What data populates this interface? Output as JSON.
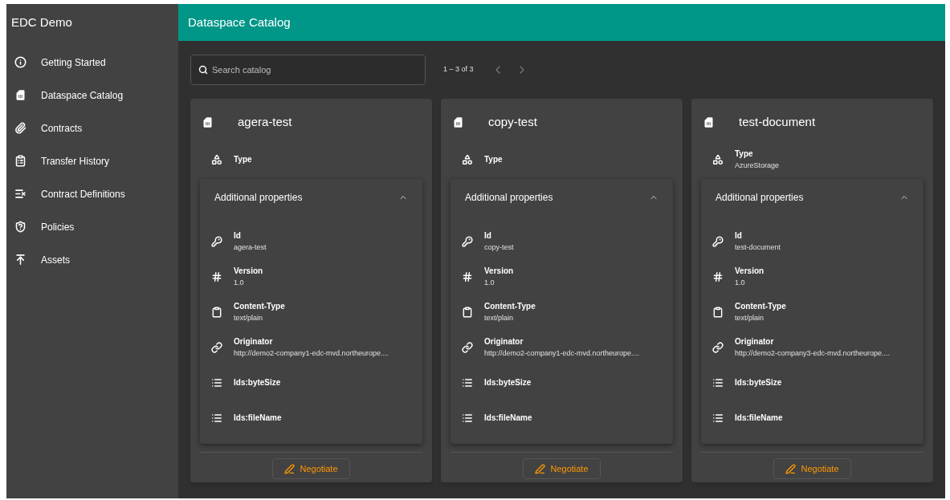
{
  "app_title": "EDC Demo",
  "nav": [
    {
      "label": "Getting Started",
      "kind": "info"
    },
    {
      "label": "Dataspace Catalog",
      "kind": "sim"
    },
    {
      "label": "Contracts",
      "kind": "clip"
    },
    {
      "label": "Transfer History",
      "kind": "clipboard"
    },
    {
      "label": "Contract Definitions",
      "kind": "listx"
    },
    {
      "label": "Policies",
      "kind": "shield"
    },
    {
      "label": "Assets",
      "kind": "upload"
    }
  ],
  "header": {
    "title": "Dataspace Catalog"
  },
  "search": {
    "placeholder": "Search catalog"
  },
  "pagination": {
    "range": "1 – 3 of 3",
    "prev_disabled": true,
    "next_disabled": true
  },
  "cards": [
    {
      "title": "agera-test",
      "type": {
        "label": "Type"
      },
      "accordion": {
        "title": "Additional properties",
        "expanded": true,
        "properties": [
          {
            "kind": "key",
            "label": "Id",
            "value": "agera-test"
          },
          {
            "kind": "hash",
            "label": "Version",
            "value": "1.0"
          },
          {
            "kind": "clipboard",
            "label": "Content-Type",
            "value": "text/plain"
          },
          {
            "kind": "link",
            "label": "Originator",
            "value": "http://demo2-company1-edc-mvd.northeurope...."
          },
          {
            "kind": "list",
            "label": "Ids:byteSize"
          },
          {
            "kind": "list",
            "label": "Ids:fileName"
          }
        ]
      },
      "action": "Negotiate"
    },
    {
      "title": "copy-test",
      "type": {
        "label": "Type"
      },
      "accordion": {
        "title": "Additional properties",
        "expanded": true,
        "properties": [
          {
            "kind": "key",
            "label": "Id",
            "value": "copy-test"
          },
          {
            "kind": "hash",
            "label": "Version",
            "value": "1.0"
          },
          {
            "kind": "clipboard",
            "label": "Content-Type",
            "value": "text/plain"
          },
          {
            "kind": "link",
            "label": "Originator",
            "value": "http://demo2-company1-edc-mvd.northeurope...."
          },
          {
            "kind": "list",
            "label": "Ids:byteSize"
          },
          {
            "kind": "list",
            "label": "Ids:fileName"
          }
        ]
      },
      "action": "Negotiate"
    },
    {
      "title": "test-document",
      "type": {
        "label": "Type",
        "value": "AzureStorage"
      },
      "accordion": {
        "title": "Additional properties",
        "expanded": true,
        "properties": [
          {
            "kind": "key",
            "label": "Id",
            "value": "test-document"
          },
          {
            "kind": "hash",
            "label": "Version",
            "value": "1.0"
          },
          {
            "kind": "clipboard",
            "label": "Content-Type",
            "value": "text/plain"
          },
          {
            "kind": "link",
            "label": "Originator",
            "value": "http://demo2-company3-edc-mvd.northeurope...."
          },
          {
            "kind": "list",
            "label": "Ids:byteSize"
          },
          {
            "kind": "list",
            "label": "Ids:fileName"
          }
        ]
      },
      "action": "Negotiate"
    }
  ]
}
